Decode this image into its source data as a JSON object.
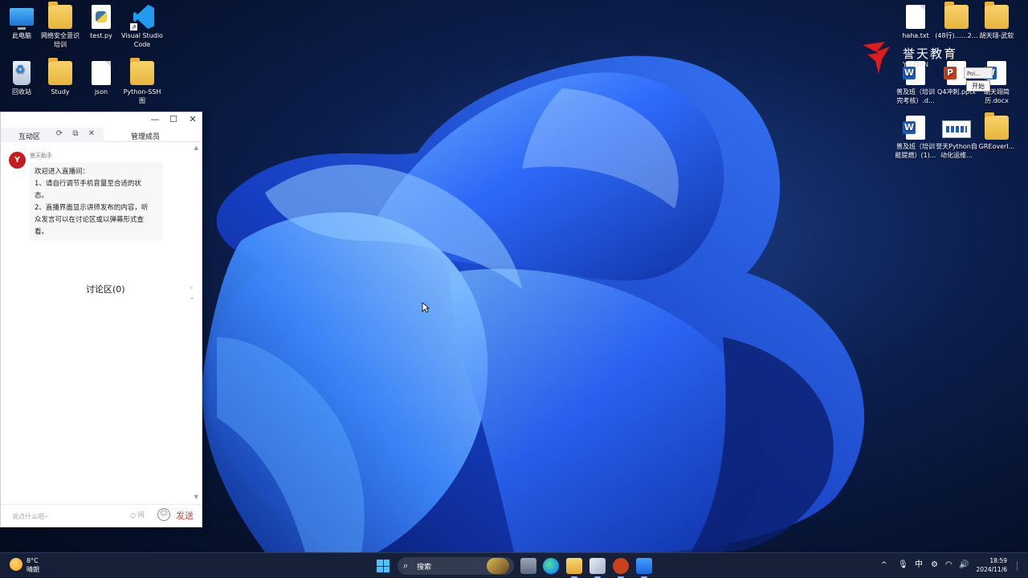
{
  "desktop": {
    "icons_left": [
      {
        "label": "此电脑",
        "icon": "computer-icon"
      },
      {
        "label": "网络安全意识培训",
        "icon": "folder-icon"
      },
      {
        "label": "test.py",
        "icon": "python-file-icon"
      },
      {
        "label": "Visual Studio Code",
        "icon": "vscode-icon"
      },
      {
        "label": "回收站",
        "icon": "recycle-bin-icon"
      },
      {
        "label": "Study",
        "icon": "folder-icon"
      },
      {
        "label": "json",
        "icon": "file-icon"
      },
      {
        "label": "Python-SSH图",
        "icon": "folder-icon"
      }
    ],
    "icons_right": [
      {
        "label": "haha.txt",
        "icon": "text-file-icon"
      },
      {
        "label": "(48行)……2…",
        "icon": "folder-icon"
      },
      {
        "label": "胡天翊-武软",
        "icon": "folder-icon"
      },
      {
        "label": "普及班（培训完考核）.d...",
        "icon": "word-doc-icon"
      },
      {
        "label": "Q4冲刺.pptx",
        "icon": "powerpoint-icon"
      },
      {
        "label": "胡天翊简历.docx",
        "icon": "word-doc-icon"
      },
      {
        "label": "普及班（培训能提燃）(1)...",
        "icon": "word-doc-icon"
      },
      {
        "label": "誉天Python自动化运维...",
        "icon": "image-file-icon"
      },
      {
        "label": "GREoverI...",
        "icon": "folder-icon"
      }
    ],
    "watermark": {
      "text": "誉天教育",
      "sub": "YU TIAN"
    },
    "mini_popup": {
      "text": "Poi..."
    },
    "mini_tooltip": {
      "text": "开始"
    }
  },
  "chat_window": {
    "tabs": {
      "interaction": "互动区",
      "members": "管理成员"
    },
    "message": {
      "sender": "誉天助手",
      "avatar_text": "Y",
      "lines": [
        "欢迎进入直播间：",
        "1、请自行调节手机音量至合适的状",
        "态。",
        "2、直播界面显示讲师发布的内容，听",
        "众发言可以在讨论区或以弹幕形式查",
        "看。"
      ]
    },
    "discussion": {
      "title": "讨论区(0)",
      "close": "×",
      "collapse": "^"
    },
    "input": {
      "placeholder": "说点什么吧~",
      "ask_label": "问",
      "send_label": "发送"
    }
  },
  "taskbar": {
    "weather": {
      "temp": "8°C",
      "condition": "晴朗"
    },
    "search": {
      "placeholder": "搜索"
    },
    "tray": {
      "ime": "中",
      "chevron": "^"
    },
    "clock": {
      "time": "18:59",
      "date": "2024/11/6"
    }
  }
}
